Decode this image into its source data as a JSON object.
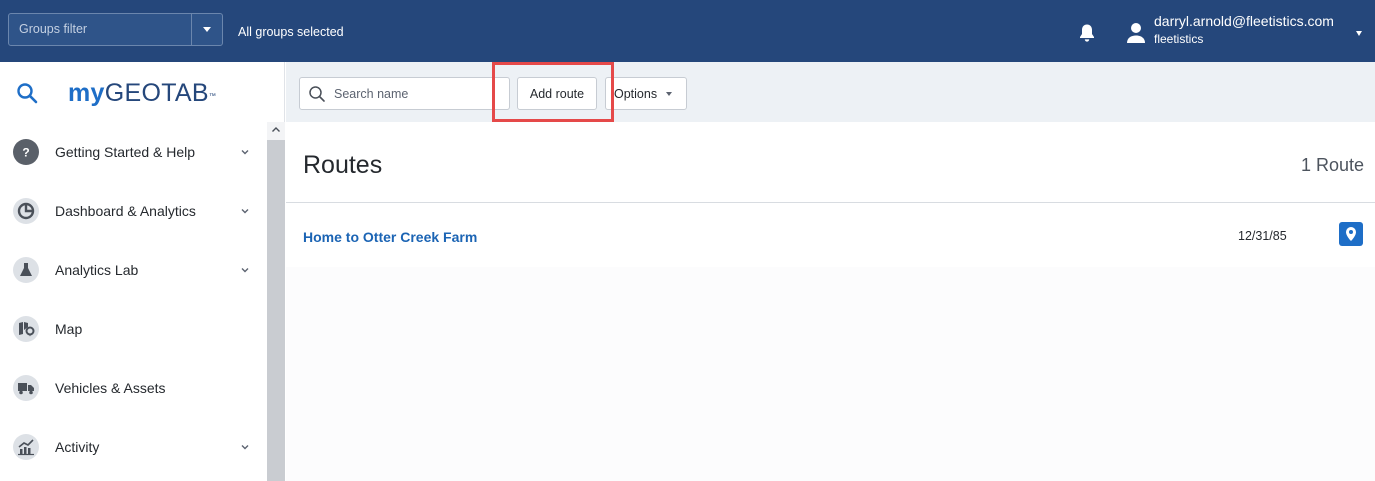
{
  "header": {
    "groups_filter_placeholder": "Groups filter",
    "groups_state": "All groups selected",
    "user_email": "darryl.arnold@fleetistics.com",
    "user_database": "fleetistics",
    "colors": {
      "bar": "#25477b",
      "accent": "#1e6ec7"
    }
  },
  "sidebar": {
    "logo": {
      "my": "my",
      "rest": "GEOTAB",
      "tm": "™"
    },
    "items": [
      {
        "label": "Getting Started & Help",
        "icon": "help-icon",
        "expandable": true
      },
      {
        "label": "Dashboard & Analytics",
        "icon": "pie-chart-icon",
        "expandable": true
      },
      {
        "label": "Analytics Lab",
        "icon": "flask-icon",
        "expandable": true
      },
      {
        "label": "Map",
        "icon": "map-icon",
        "expandable": false
      },
      {
        "label": "Vehicles & Assets",
        "icon": "truck-icon",
        "expandable": false
      },
      {
        "label": "Activity",
        "icon": "activity-chart-icon",
        "expandable": true
      }
    ]
  },
  "toolbar": {
    "search_placeholder": "Search name",
    "add_route_label": "Add route",
    "options_label": "Options"
  },
  "main": {
    "title": "Routes",
    "count": "1 Route",
    "routes": [
      {
        "name": "Home to Otter Creek Farm",
        "date": "12/31/85"
      }
    ]
  }
}
